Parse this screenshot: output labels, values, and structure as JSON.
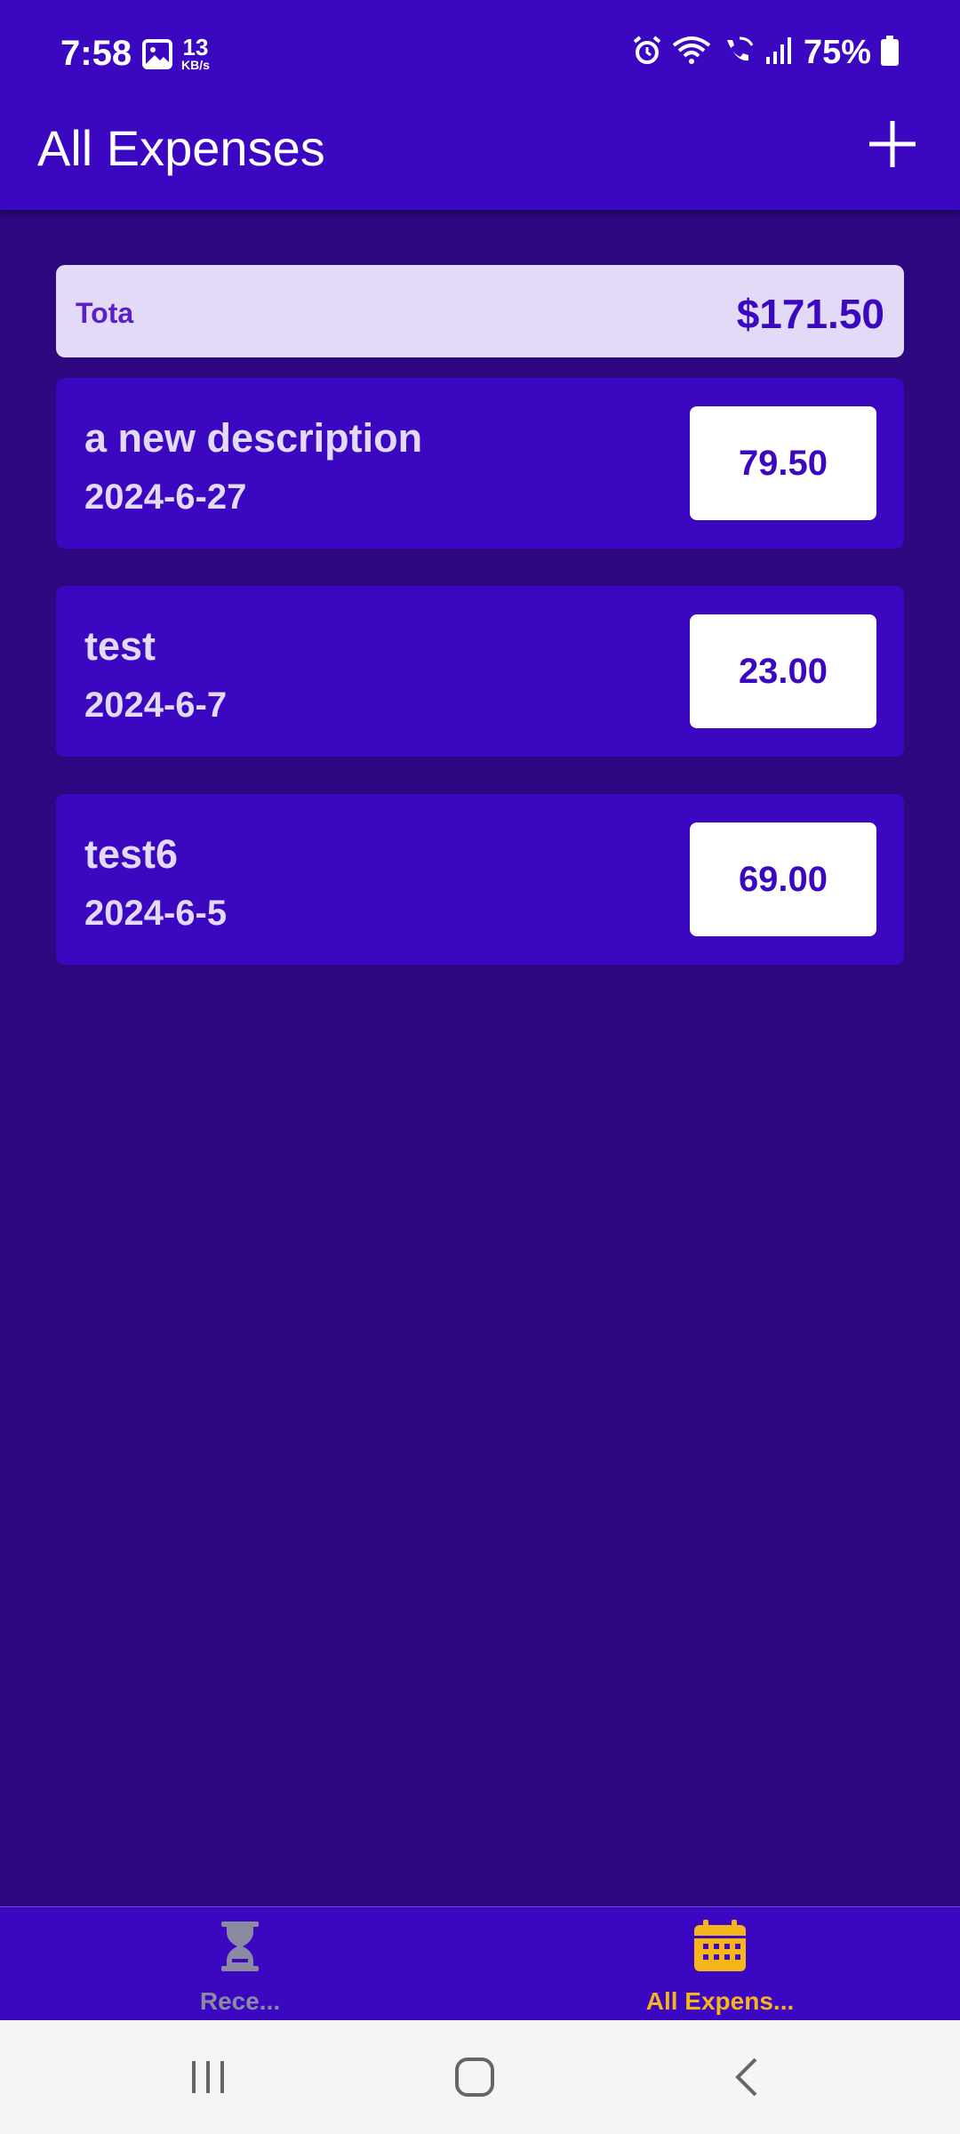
{
  "status_bar": {
    "time": "7:58",
    "net_speed_value": "13",
    "net_speed_unit": "KB/s",
    "battery": "75%",
    "icons": [
      "gallery-icon",
      "alarm-icon",
      "wifi-icon",
      "wifi-calling-icon",
      "signal-icon",
      "battery-icon"
    ]
  },
  "app_bar": {
    "title": "All Expenses",
    "add_icon": "plus-icon"
  },
  "summary": {
    "label": "Tota",
    "value": "$171.50"
  },
  "expenses": [
    {
      "description": "a new description",
      "date": "2024-6-27",
      "amount": "79.50"
    },
    {
      "description": "test",
      "date": "2024-6-7",
      "amount": "23.00"
    },
    {
      "description": "test6",
      "date": "2024-6-5",
      "amount": "69.00"
    }
  ],
  "bottom_nav": {
    "tabs": [
      {
        "label": "Rece...",
        "icon": "hourglass-icon",
        "active": false
      },
      {
        "label": "All Expens...",
        "icon": "calendar-icon",
        "active": true
      }
    ]
  },
  "colors": {
    "background": "#2c0780",
    "primary": "#3c07c0",
    "card_light": "#e3daf7",
    "accent": "#f7b51c"
  },
  "system_nav": [
    "recents-icon",
    "home-icon",
    "back-icon"
  ]
}
